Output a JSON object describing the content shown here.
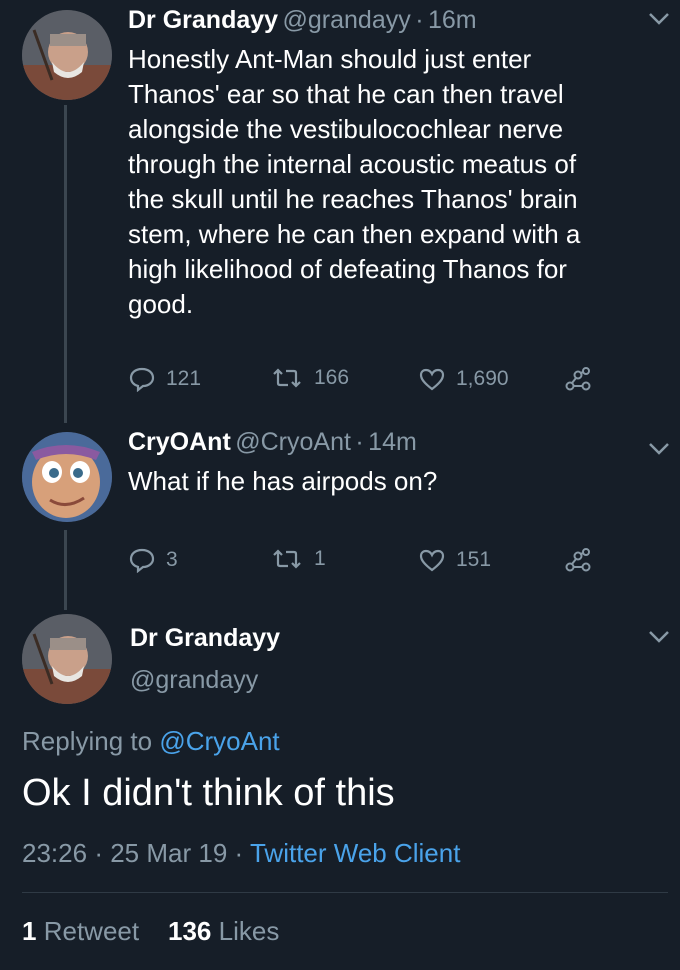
{
  "tweets": [
    {
      "name": "Dr Grandayy",
      "handle": "@grandayy",
      "separator": "·",
      "time": "16m",
      "text_lines": [
        "Honestly Ant-Man should just enter",
        "Thanos' ear so that he can then travel",
        "alongside the vestibulocochlear nerve",
        "through the internal acoustic meatus of",
        "the skull until he reaches Thanos' brain",
        "stem, where he can then expand with a",
        "high likelihood of defeating Thanos for",
        "good."
      ],
      "replies": "121",
      "retweets": "166",
      "likes": "1,690"
    },
    {
      "name": "CryOAnt",
      "handle": "@CryoAnt",
      "separator": "·",
      "time": "14m",
      "text_lines": [
        "What if he has airpods on?"
      ],
      "replies": "3",
      "retweets": "1",
      "likes": "151"
    }
  ],
  "main_tweet": {
    "name": "Dr Grandayy",
    "handle": "@grandayy",
    "replying_prefix": "Replying to ",
    "replying_to": "@CryoAnt",
    "text": "Ok I didn't think of this",
    "time": "23:26",
    "separator": "·",
    "date": "25 Mar 19",
    "separator2": "·",
    "client": "Twitter Web Client",
    "retweet_count": "1",
    "retweet_label": "Retweet",
    "like_count": "136",
    "like_label": "Likes"
  },
  "colors": {
    "background": "#161e28",
    "secondary_text": "#8899a6",
    "link": "#4aa3ea"
  }
}
